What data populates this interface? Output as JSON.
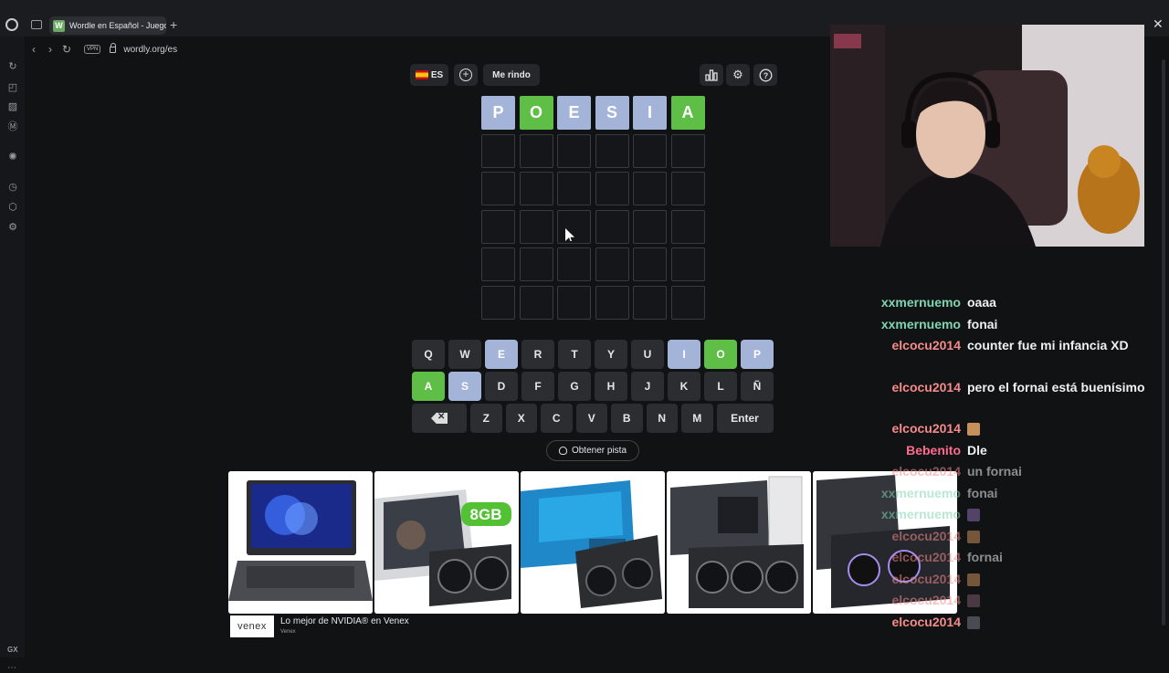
{
  "browser": {
    "tab_favicon": "W",
    "tab_title": "Wordle en Español - Juego",
    "url": "wordly.org/es",
    "vpn_label": "VPN",
    "sidebar_gx": "GX"
  },
  "header": {
    "lang_label": "ES",
    "give_up_label": "Me rindo",
    "icons": [
      "stats-icon",
      "settings-icon",
      "help-icon"
    ]
  },
  "grid": {
    "rows": [
      [
        {
          "letter": "P",
          "state": "present"
        },
        {
          "letter": "O",
          "state": "correct"
        },
        {
          "letter": "E",
          "state": "present"
        },
        {
          "letter": "S",
          "state": "present"
        },
        {
          "letter": "I",
          "state": "present"
        },
        {
          "letter": "A",
          "state": "correct"
        }
      ],
      [
        {
          "letter": "",
          "state": "empty"
        },
        {
          "letter": "",
          "state": "empty"
        },
        {
          "letter": "",
          "state": "empty"
        },
        {
          "letter": "",
          "state": "empty"
        },
        {
          "letter": "",
          "state": "empty"
        },
        {
          "letter": "",
          "state": "empty"
        }
      ],
      [
        {
          "letter": "",
          "state": "empty"
        },
        {
          "letter": "",
          "state": "empty"
        },
        {
          "letter": "",
          "state": "empty"
        },
        {
          "letter": "",
          "state": "empty"
        },
        {
          "letter": "",
          "state": "empty"
        },
        {
          "letter": "",
          "state": "empty"
        }
      ],
      [
        {
          "letter": "",
          "state": "empty"
        },
        {
          "letter": "",
          "state": "empty"
        },
        {
          "letter": "",
          "state": "empty"
        },
        {
          "letter": "",
          "state": "empty"
        },
        {
          "letter": "",
          "state": "empty"
        },
        {
          "letter": "",
          "state": "empty"
        }
      ],
      [
        {
          "letter": "",
          "state": "empty"
        },
        {
          "letter": "",
          "state": "empty"
        },
        {
          "letter": "",
          "state": "empty"
        },
        {
          "letter": "",
          "state": "empty"
        },
        {
          "letter": "",
          "state": "empty"
        },
        {
          "letter": "",
          "state": "empty"
        }
      ],
      [
        {
          "letter": "",
          "state": "empty"
        },
        {
          "letter": "",
          "state": "empty"
        },
        {
          "letter": "",
          "state": "empty"
        },
        {
          "letter": "",
          "state": "empty"
        },
        {
          "letter": "",
          "state": "empty"
        },
        {
          "letter": "",
          "state": "empty"
        }
      ]
    ]
  },
  "keyboard": {
    "row1": [
      {
        "k": "Q",
        "s": ""
      },
      {
        "k": "W",
        "s": ""
      },
      {
        "k": "E",
        "s": "present"
      },
      {
        "k": "R",
        "s": ""
      },
      {
        "k": "T",
        "s": ""
      },
      {
        "k": "Y",
        "s": ""
      },
      {
        "k": "U",
        "s": ""
      },
      {
        "k": "I",
        "s": "present"
      },
      {
        "k": "O",
        "s": "correct"
      },
      {
        "k": "P",
        "s": "present"
      }
    ],
    "row2": [
      {
        "k": "A",
        "s": "correct"
      },
      {
        "k": "S",
        "s": "present"
      },
      {
        "k": "D",
        "s": ""
      },
      {
        "k": "F",
        "s": ""
      },
      {
        "k": "G",
        "s": ""
      },
      {
        "k": "H",
        "s": ""
      },
      {
        "k": "J",
        "s": ""
      },
      {
        "k": "K",
        "s": ""
      },
      {
        "k": "L",
        "s": ""
      },
      {
        "k": "Ñ",
        "s": ""
      }
    ],
    "row3": [
      {
        "k": "Z",
        "s": ""
      },
      {
        "k": "X",
        "s": ""
      },
      {
        "k": "C",
        "s": ""
      },
      {
        "k": "V",
        "s": ""
      },
      {
        "k": "B",
        "s": ""
      },
      {
        "k": "N",
        "s": ""
      },
      {
        "k": "M",
        "s": ""
      }
    ],
    "enter_label": "Enter"
  },
  "hint_label": "Obtener pista",
  "ads": {
    "badge_8gb": "8GB",
    "footer_logo": "venex",
    "footer_title": "Lo mejor de NVIDIA® en Venex",
    "footer_source": "Venex"
  },
  "colors": {
    "correct": "#5fbe45",
    "present": "#a3b4d8",
    "empty_cell": "#151619",
    "key_default": "#2c2d31"
  },
  "chat": [
    {
      "user": "xxmernuemo",
      "color": "#7fd6b0",
      "text": "oaaa"
    },
    {
      "user": "xxmernuemo",
      "color": "#7fd6b0",
      "text": "fonai"
    },
    {
      "user": "elcocu2014",
      "color": "#f58b8b",
      "text": "counter fue mi infancia XD"
    },
    {
      "user": "elcocu2014",
      "color": "#f58b8b",
      "text": "pero el fornai está buenísimo"
    },
    {
      "user": "elcocu2014",
      "color": "#f58b8b",
      "text": "",
      "emote": "#c98f5a"
    },
    {
      "user": "Bebenito",
      "color": "#ff6b8f",
      "text": "Dle"
    },
    {
      "user": "elcocu2014",
      "color": "#f58b8b",
      "text": "un fornai",
      "faded": true
    },
    {
      "user": "xxmernuemo",
      "color": "#7fd6b0",
      "text": "fonai",
      "faded": true
    },
    {
      "user": "xxmernuemo",
      "color": "#7fd6b0",
      "text": "",
      "emote": "#8a6bb0",
      "faded": true
    },
    {
      "user": "elcocu2014",
      "color": "#f58b8b",
      "text": "",
      "emote": "#c98f5a",
      "faded": true
    },
    {
      "user": "elcocu2014",
      "color": "#f58b8b",
      "text": "fornai",
      "faded": true
    },
    {
      "user": "elcocu2014",
      "color": "#f58b8b",
      "text": "",
      "emote": "#c98f5a",
      "faded": true
    },
    {
      "user": "elcocu2014",
      "color": "#f58b8b",
      "text": "",
      "emote": "#7a5a6a",
      "faded": true
    },
    {
      "user": "elcocu2014",
      "color": "#f58b8b",
      "text": "",
      "emote": "#4a4a52"
    }
  ]
}
